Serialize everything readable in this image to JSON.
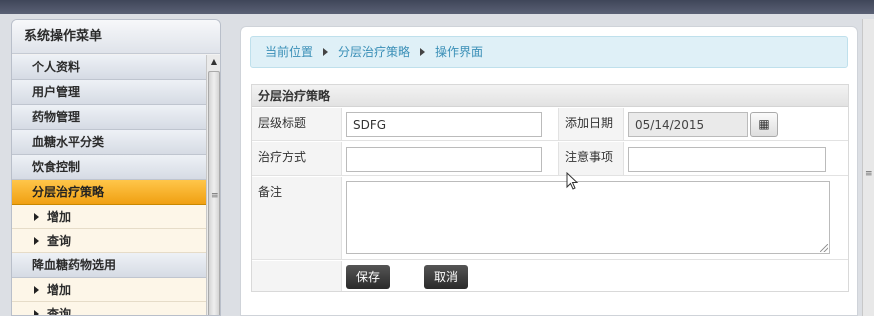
{
  "sidebar": {
    "title": "系统操作菜单",
    "items": [
      {
        "label": "个人资料",
        "type": "menu",
        "active": false
      },
      {
        "label": "用户管理",
        "type": "menu",
        "active": false
      },
      {
        "label": "药物管理",
        "type": "menu",
        "active": false
      },
      {
        "label": "血糖水平分类",
        "type": "menu",
        "active": false
      },
      {
        "label": "饮食控制",
        "type": "menu",
        "active": false
      },
      {
        "label": "分层治疗策略",
        "type": "menu",
        "active": true
      },
      {
        "label": "增加",
        "type": "sub"
      },
      {
        "label": "查询",
        "type": "sub"
      },
      {
        "label": "降血糖药物选用",
        "type": "menu",
        "active": false
      },
      {
        "label": "增加",
        "type": "sub"
      },
      {
        "label": "查询",
        "type": "sub"
      }
    ]
  },
  "breadcrumb": [
    "当前位置",
    "分层治疗策略",
    "操作界面"
  ],
  "form": {
    "title": "分层治疗策略",
    "level_title_label": "层级标题",
    "level_title_value": "SDFG",
    "add_date_label": "添加日期",
    "add_date_value": "05/14/2015",
    "treatment_label": "治疗方式",
    "treatment_value": "",
    "notes_label": "注意事项",
    "notes_value": "",
    "remarks_label": "备注",
    "remarks_value": "",
    "save_label": "保存",
    "cancel_label": "取消"
  },
  "colors": {
    "active_menu": "#f0a012",
    "breadcrumb_text": "#3a8fb7"
  }
}
